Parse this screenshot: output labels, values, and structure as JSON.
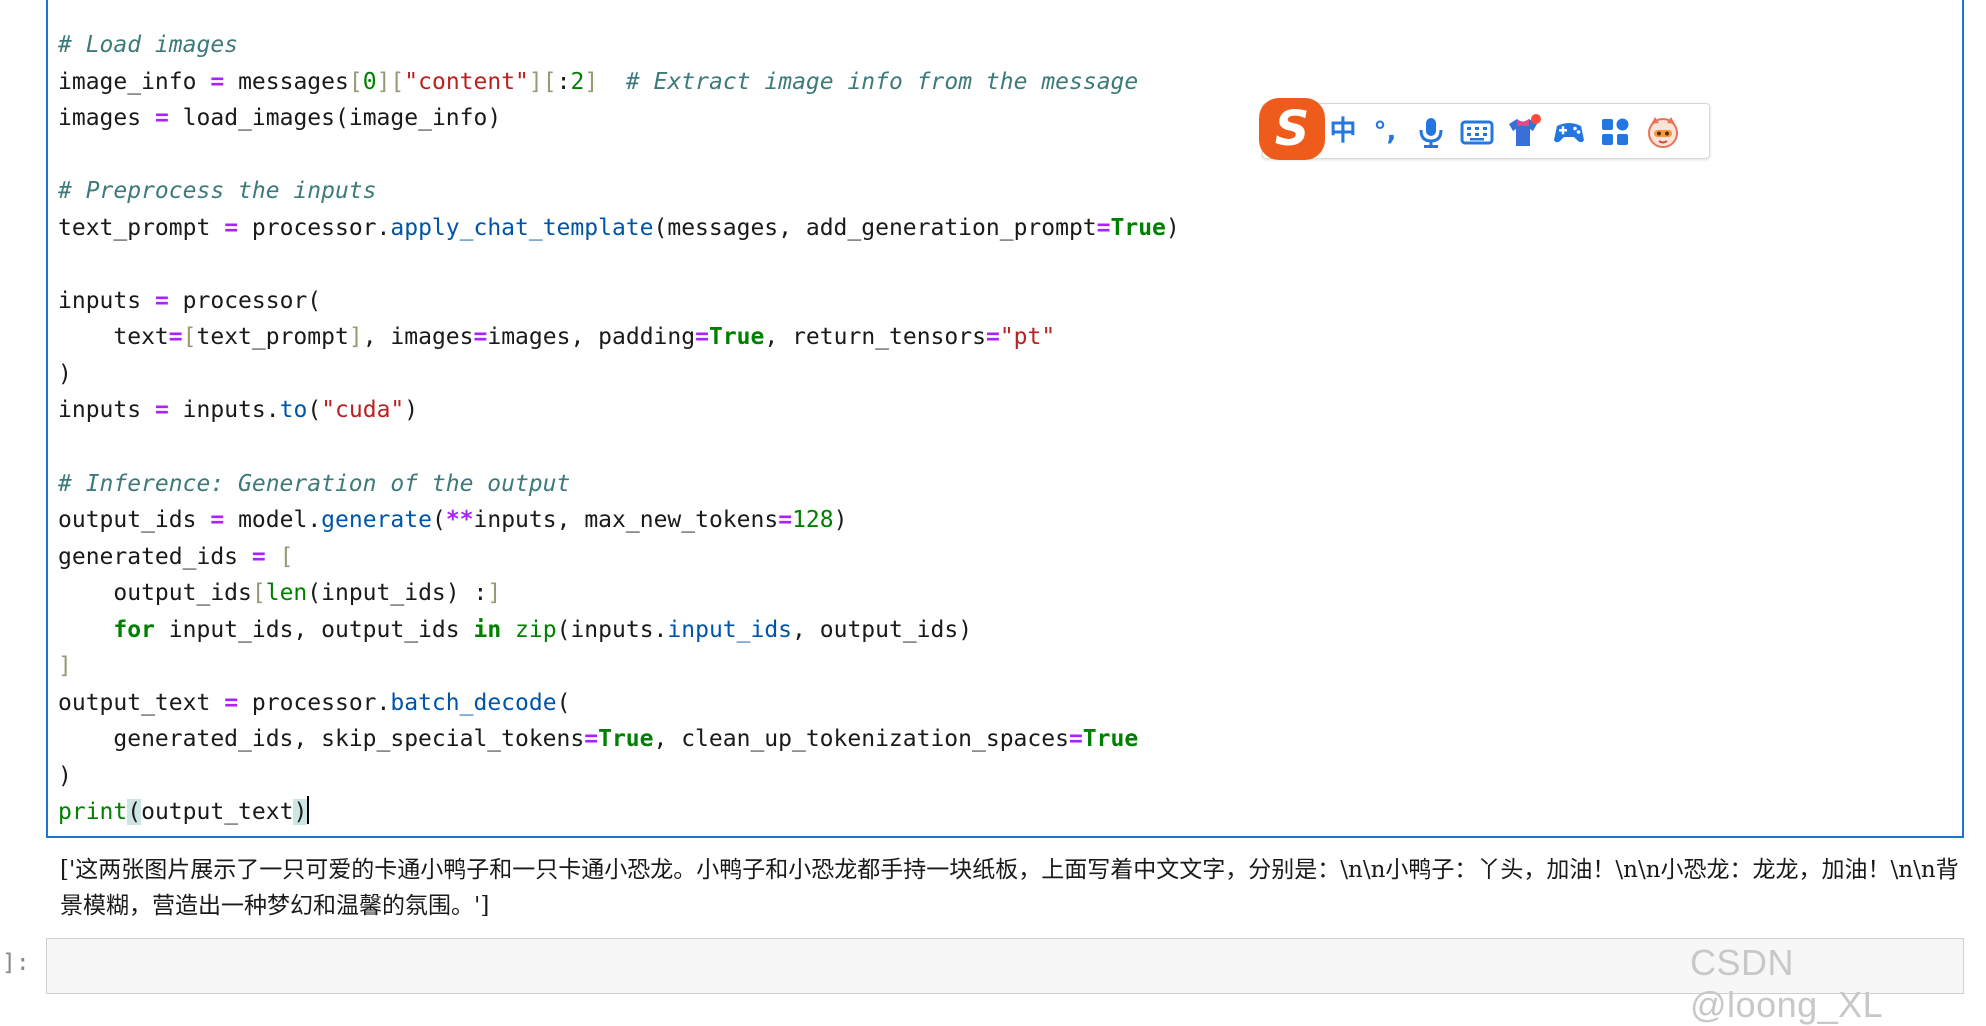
{
  "code_cell": {
    "lines": [
      "# Load images",
      "image_info = messages[0][\"content\"][:2]  # Extract image info from the message",
      "images = load_images(image_info)",
      "",
      "# Preprocess the inputs",
      "text_prompt = processor.apply_chat_template(messages, add_generation_prompt=True)",
      "",
      "inputs = processor(",
      "    text=[text_prompt], images=images, padding=True, return_tensors=\"pt\"",
      ")",
      "inputs = inputs.to(\"cuda\")",
      "",
      "# Inference: Generation of the output",
      "output_ids = model.generate(**inputs, max_new_tokens=128)",
      "generated_ids = [",
      "    output_ids[len(input_ids) :]",
      "    for input_ids, output_ids in zip(inputs.input_ids, output_ids)",
      "]",
      "output_text = processor.batch_decode(",
      "    generated_ids, skip_special_tokens=True, clean_up_tokenization_spaces=True",
      ")",
      "print(output_text)"
    ]
  },
  "output": {
    "text": "['这两张图片展示了一只可爱的卡通小鸭子和一只卡通小恐龙。小鸭子和小恐龙都手持一块纸板，上面写着中文文字，分别是：\\n\\n小鸭子：丫头，加油！\\n\\n小恐龙：龙龙，加油！\\n\\n背景模糊，营造出一种梦幻和温馨的氛围。']"
  },
  "next_cell": {
    "prompt": "]:"
  },
  "watermark": {
    "text": "CSDN @loong_XL"
  },
  "ime_toolbar": {
    "logo_letter": "S",
    "chinese_mode": "中",
    "punctuation": "°,",
    "icons": [
      "sogou-logo-icon",
      "chinese-mode-icon",
      "punctuation-icon",
      "microphone-icon",
      "keyboard-icon",
      "skin-shirt-icon",
      "game-controller-icon",
      "apps-grid-icon",
      "mascot-icon"
    ],
    "colors": {
      "accent": "#2477e0",
      "logo": "#ee5b1a",
      "badge": "#ff4a3d"
    }
  },
  "colors": {
    "cell_border": "#1976d2",
    "comment": "#3d7a7a",
    "keyword": "#008000",
    "string": "#ba2121",
    "operator": "#aa22ff",
    "function": "#0055aa"
  }
}
